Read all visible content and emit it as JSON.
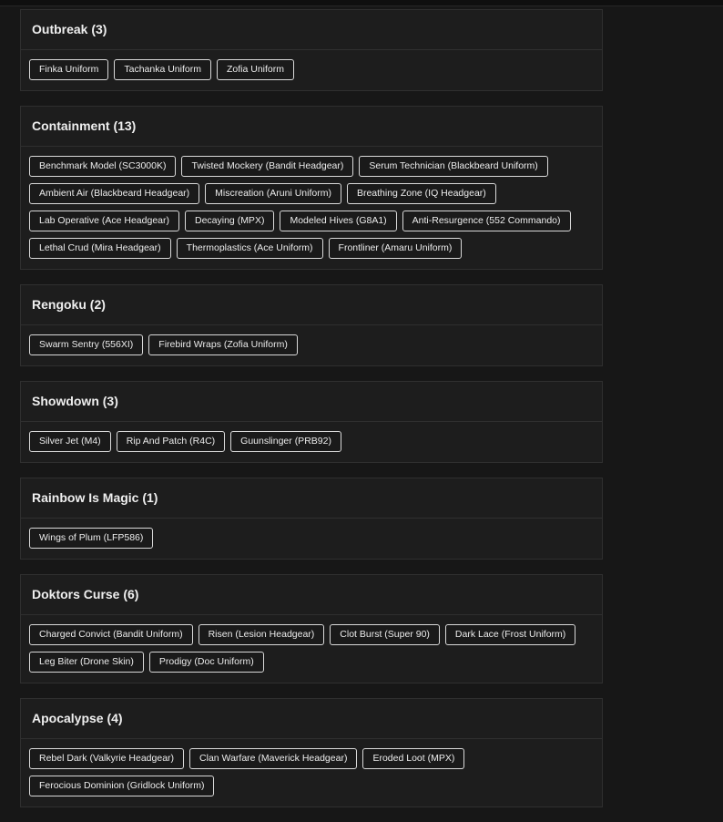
{
  "sections": [
    {
      "title": "Outbreak (3)",
      "items": [
        "Finka Uniform",
        "Tachanka Uniform",
        "Zofia Uniform"
      ]
    },
    {
      "title": "Containment (13)",
      "items": [
        "Benchmark Model (SC3000K)",
        "Twisted Mockery (Bandit Headgear)",
        "Serum Technician (Blackbeard Uniform)",
        "Ambient Air (Blackbeard Headgear)",
        "Miscreation (Aruni Uniform)",
        "Breathing Zone (IQ Headgear)",
        "Lab Operative (Ace Headgear)",
        "Decaying (MPX)",
        "Modeled Hives (G8A1)",
        "Anti-Resurgence (552 Commando)",
        "Lethal Crud (Mira Headgear)",
        "Thermoplastics (Ace Uniform)",
        "Frontliner (Amaru Uniform)"
      ]
    },
    {
      "title": "Rengoku (2)",
      "items": [
        "Swarm Sentry (556XI)",
        "Firebird Wraps (Zofia Uniform)"
      ]
    },
    {
      "title": "Showdown (3)",
      "items": [
        "Silver Jet (M4)",
        "Rip And Patch (R4C)",
        "Guunslinger (PRB92)"
      ]
    },
    {
      "title": "Rainbow Is Magic (1)",
      "items": [
        "Wings of Plum (LFP586)"
      ]
    },
    {
      "title": "Doktors Curse (6)",
      "items": [
        "Charged Convict (Bandit Uniform)",
        "Risen (Lesion Headgear)",
        "Clot Burst (Super 90)",
        "Dark Lace (Frost Uniform)",
        "Leg Biter (Drone Skin)",
        "Prodigy (Doc Uniform)"
      ]
    },
    {
      "title": "Apocalypse (4)",
      "items": [
        "Rebel Dark (Valkyrie Headgear)",
        "Clan Warfare (Maverick Headgear)",
        "Eroded Loot (MPX)",
        "Ferocious Dominion (Gridlock Uniform)"
      ]
    }
  ]
}
